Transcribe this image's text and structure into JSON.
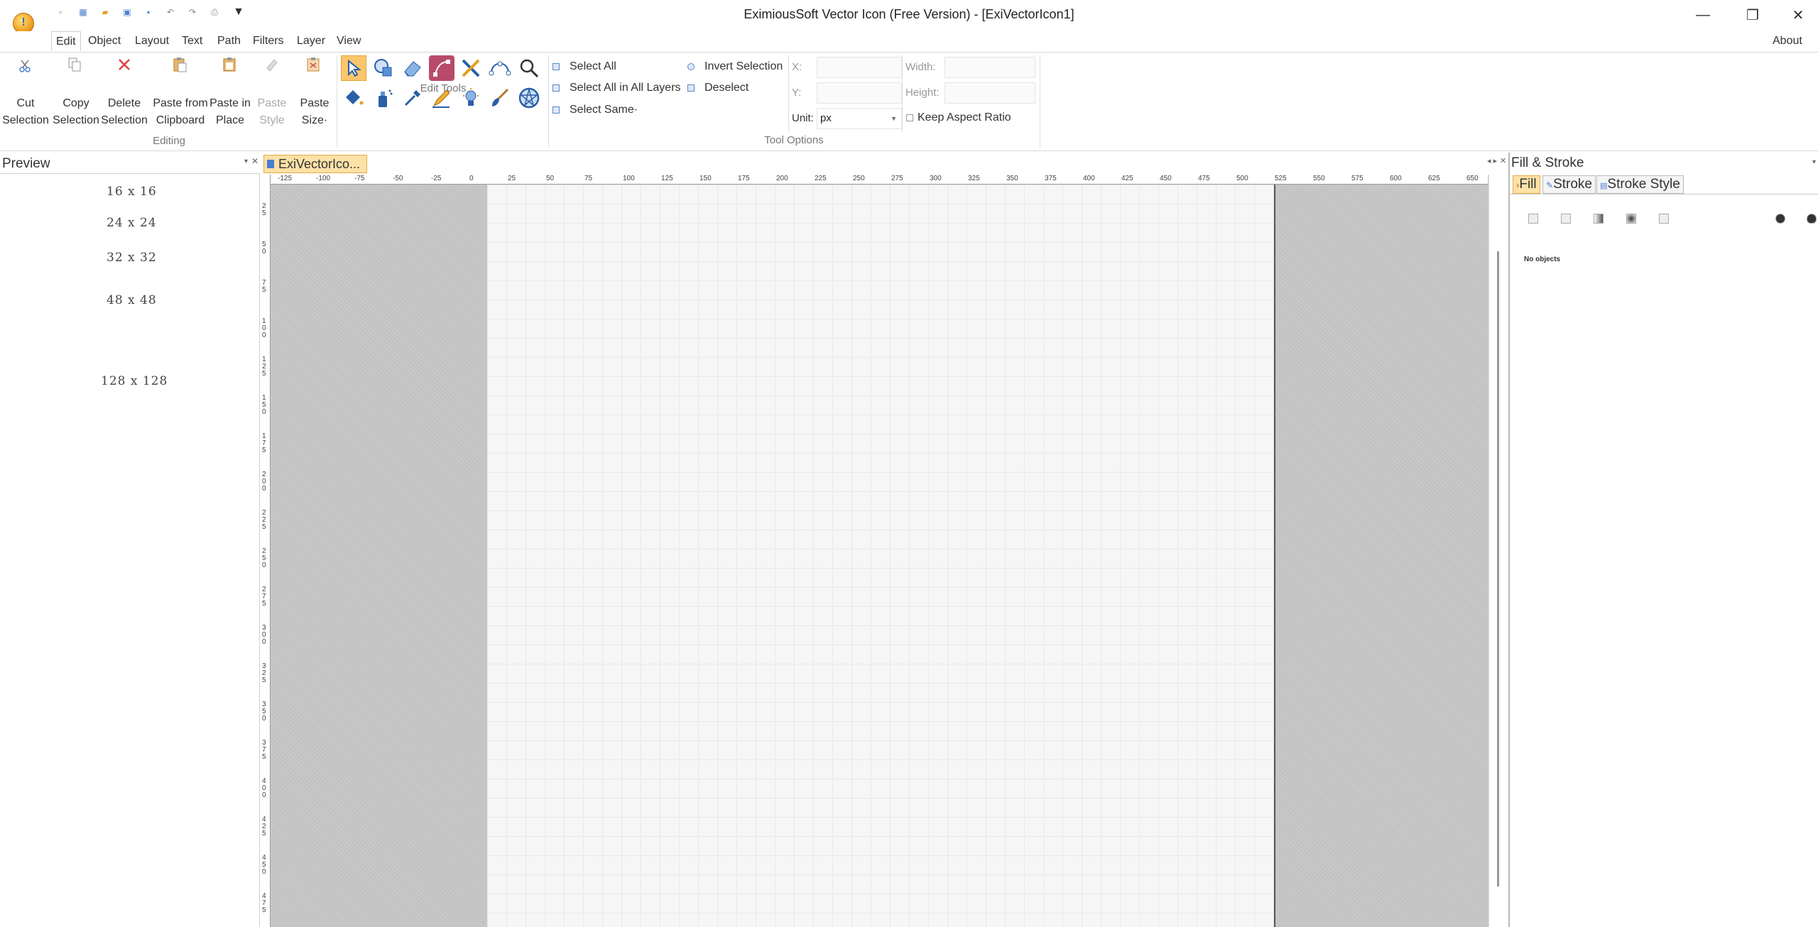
{
  "window": {
    "title": "EximiousSoft Vector Icon (Free Version) - [ExiVectorIcon1]",
    "minimize": "—",
    "restore": "❐",
    "close": "✕"
  },
  "menu": {
    "items": [
      "Edit",
      "Object",
      "Layout",
      "Text",
      "Path",
      "Filters",
      "Layer",
      "View"
    ],
    "about": "About"
  },
  "ribbon": {
    "editing": {
      "label": "Editing",
      "cut_l1": "Cut",
      "cut_l2": "Selection",
      "copy_l1": "Copy",
      "copy_l2": "Selection",
      "delete_l1": "Delete",
      "delete_l2": "Selection",
      "paste_clip_l1": "Paste from",
      "paste_clip_l2": "Clipboard",
      "paste_place_l1": "Paste in",
      "paste_place_l2": "Place",
      "paste_style_l1": "Paste",
      "paste_style_l2": "Style",
      "paste_size_l1": "Paste",
      "paste_size_l2": "Size·"
    },
    "edit_tools": {
      "label": "Edit Tools",
      "tools_row1": [
        "select-arrow-icon",
        "shape-icon",
        "eraser-icon",
        "node-edit-icon",
        "cross-tool-icon",
        "bezier-icon",
        "zoom-icon"
      ],
      "tools_row2": [
        "fill-bucket-icon",
        "spray-icon",
        "eyedropper-icon",
        "pencil-icon",
        "lightbulb-icon",
        "brush-icon",
        "star-polygon-icon"
      ]
    },
    "tool_options": {
      "label": "Tool Options",
      "select_all": "Select All",
      "select_all_layers": "Select All in All Layers",
      "select_same": "Select Same·",
      "invert_selection": "Invert Selection",
      "deselect": "Deselect",
      "x_label": "X:",
      "y_label": "Y:",
      "width_label": "Width:",
      "height_label": "Height:",
      "unit_label": "Unit:",
      "unit_value": "px",
      "keep_aspect": "Keep Aspect Ratio"
    }
  },
  "preview": {
    "title": "Preview",
    "sizes": [
      "16 x 16",
      "24 x 24",
      "32 x 32",
      "48 x 48",
      "128 x 128"
    ]
  },
  "document": {
    "tab_label": "ExiVectorIco...",
    "hruler_labels": [
      "-125",
      "-100",
      "-75",
      "-50",
      "-25",
      "0",
      "25",
      "50",
      "75",
      "100",
      "125",
      "150",
      "175",
      "200",
      "225",
      "250",
      "275",
      "300",
      "325",
      "350",
      "375",
      "400",
      "425",
      "450",
      "475",
      "500",
      "525",
      "550",
      "575",
      "600",
      "625",
      "650"
    ],
    "vruler_labels": [
      "25",
      "50",
      "75",
      "100",
      "125",
      "150",
      "175",
      "200",
      "225",
      "250",
      "275",
      "300",
      "325",
      "350",
      "375",
      "400",
      "425",
      "450",
      "475"
    ]
  },
  "fill_stroke": {
    "title": "Fill & Stroke",
    "tab_fill": "Fill",
    "tab_stroke": "Stroke",
    "tab_stroke_style": "Stroke Style",
    "status": "No objects"
  }
}
